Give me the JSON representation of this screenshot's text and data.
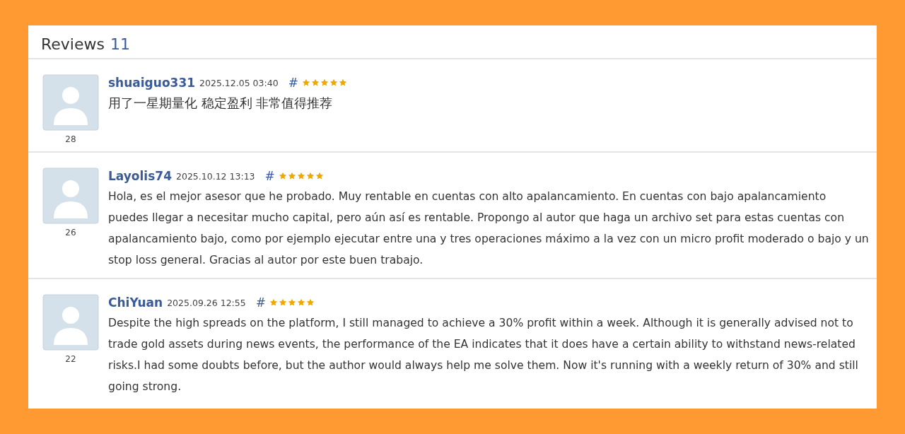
{
  "header": {
    "title": "Reviews",
    "count": "11"
  },
  "reviews": [
    {
      "author": "shuaiguo331",
      "date": "2025.12.05 03:40",
      "link": "#",
      "stars": 5,
      "rating_count": "28",
      "text": "用了一星期量化 稳定盈利 非常值得推荐"
    },
    {
      "author": "Layolis74",
      "date": "2025.10.12 13:13",
      "link": "#",
      "stars": 5,
      "rating_count": "26",
      "text": "Hola, es el mejor asesor que he probado. Muy rentable en cuentas con alto apalancamiento. En cuentas con bajo apalancamiento puedes llegar a necesitar mucho capital, pero aún así es rentable. Propongo al autor que haga un archivo set para estas cuentas con apalancamiento bajo, como por ejemplo ejecutar entre una y tres operaciones máximo a la vez con un micro profit moderado o bajo y un stop loss general. Gracias al autor por este buen trabajo."
    },
    {
      "author": "ChiYuan",
      "date": "2025.09.26 12:55",
      "link": "#",
      "stars": 5,
      "rating_count": "22",
      "text": "Despite the high spreads on the platform, I still managed to achieve a 30% profit within a week. Although it is generally advised not to trade gold assets during news events, the performance of the EA indicates that it does have a certain ability to withstand news-related risks.I had some doubts before, but the author would always help me solve them. Now it's running with a weekly return of 30% and still going strong."
    }
  ]
}
